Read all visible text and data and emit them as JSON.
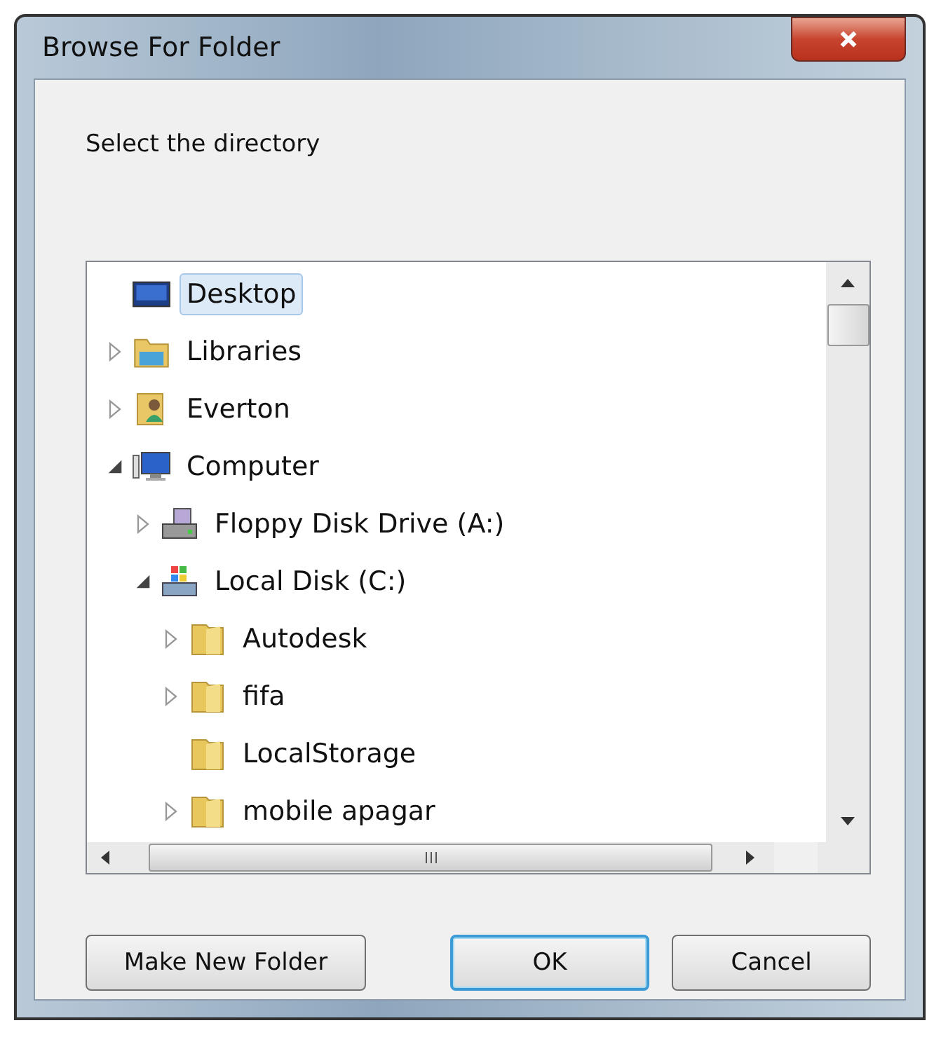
{
  "window": {
    "title": "Browse For Folder"
  },
  "prompt": "Select the directory",
  "tree": [
    {
      "label": "Desktop",
      "kind": "desktop",
      "expandable": false,
      "selected": true
    },
    {
      "label": "Libraries",
      "kind": "libraries",
      "expandable": true,
      "expanded": false,
      "selected": false
    },
    {
      "label": "Everton",
      "kind": "user",
      "expandable": true,
      "expanded": false,
      "selected": false
    },
    {
      "label": "Computer",
      "kind": "computer",
      "expandable": true,
      "expanded": true,
      "selected": false,
      "children": [
        {
          "label": "Floppy Disk Drive (A:)",
          "kind": "floppy",
          "expandable": true,
          "expanded": false,
          "selected": false
        },
        {
          "label": "Local Disk (C:)",
          "kind": "disk",
          "expandable": true,
          "expanded": true,
          "selected": false,
          "children": [
            {
              "label": "Autodesk",
              "kind": "folder",
              "expandable": true,
              "expanded": false,
              "selected": false
            },
            {
              "label": "fifa",
              "kind": "folder",
              "expandable": true,
              "expanded": false,
              "selected": false
            },
            {
              "label": "LocalStorage",
              "kind": "folder",
              "expandable": false,
              "selected": false
            },
            {
              "label": "mobile apagar",
              "kind": "folder",
              "expandable": true,
              "expanded": false,
              "selected": false
            }
          ]
        }
      ]
    }
  ],
  "buttons": [
    {
      "label": "Make New Folder",
      "default": false
    },
    {
      "label": "OK",
      "default": true
    },
    {
      "label": "Cancel",
      "default": false
    }
  ]
}
